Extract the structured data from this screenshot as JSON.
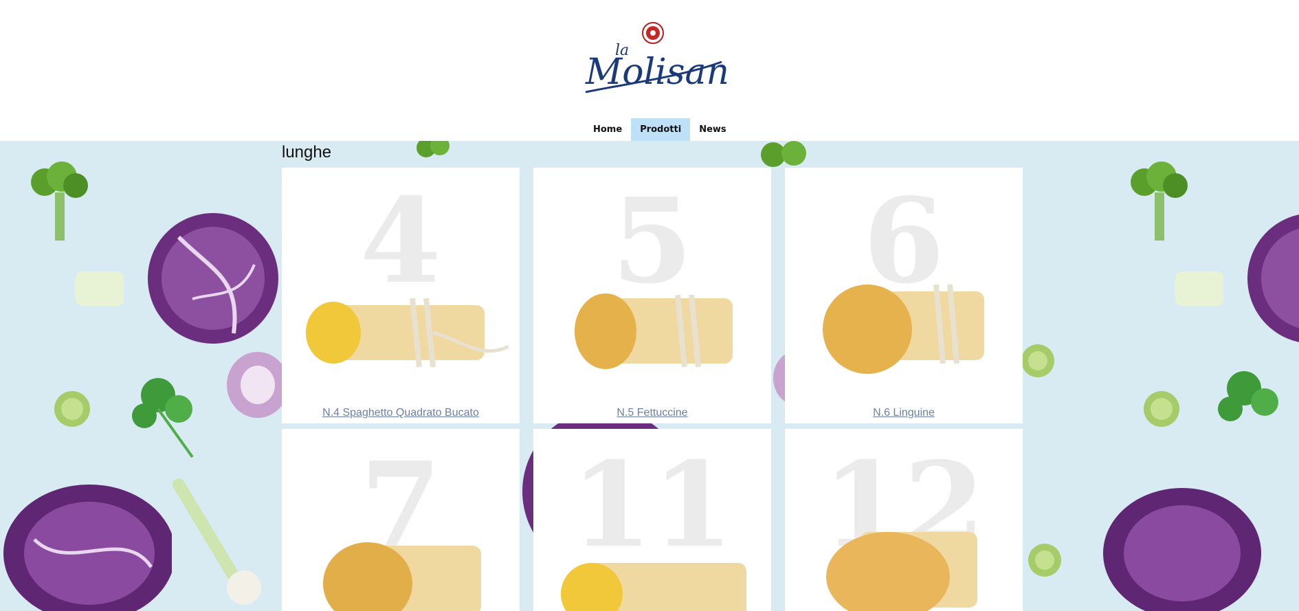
{
  "brand": {
    "logo_text_small": "la",
    "logo_text": "Molisana",
    "accent": "#1b3a7a"
  },
  "nav": {
    "items": [
      {
        "label": "Home",
        "active": false
      },
      {
        "label": "Prodotti",
        "active": true
      },
      {
        "label": "News",
        "active": false
      }
    ]
  },
  "section": {
    "title": "lunghe"
  },
  "products": [
    {
      "number": "4",
      "title": "N.4 Spaghetto Quadrato Bucato"
    },
    {
      "number": "5",
      "title": "N.5 Fettuccine"
    },
    {
      "number": "6",
      "title": "N.6 Linguine"
    },
    {
      "number": "7",
      "title": ""
    },
    {
      "number": "11",
      "title": ""
    },
    {
      "number": "12",
      "title": ""
    }
  ],
  "colors": {
    "nav_active": "#bfe1f7",
    "background": "#d8ebf2",
    "link": "#6b7fa6"
  }
}
